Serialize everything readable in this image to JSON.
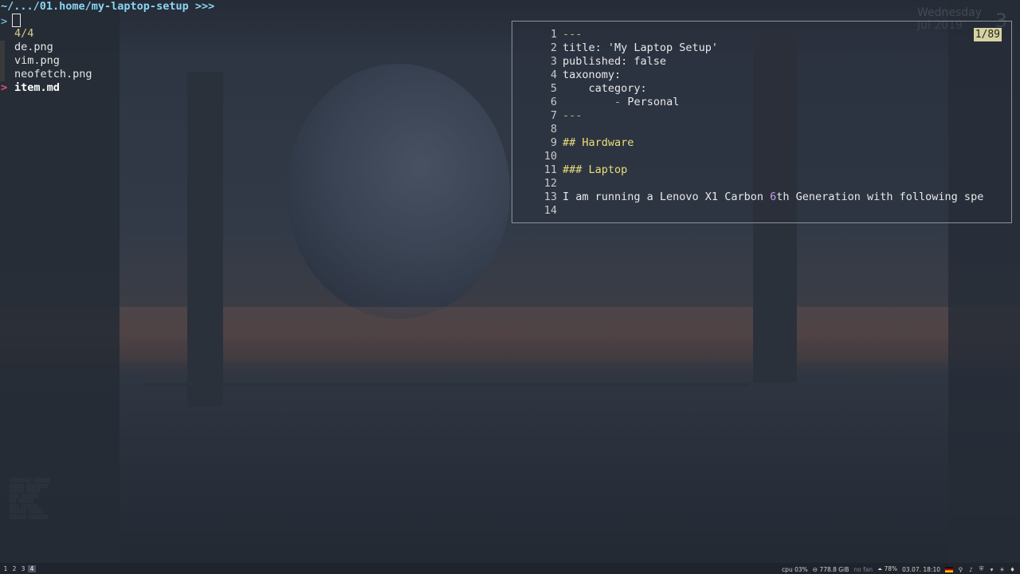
{
  "terminal": {
    "path": "~/.../01.home/my-laptop-setup",
    "prompt_suffix": ">>>",
    "input_prompt": ">",
    "count": "4/4",
    "selection_marker": ">",
    "files": [
      {
        "name": "de.png"
      },
      {
        "name": "vim.png"
      },
      {
        "name": "neofetch.png"
      },
      {
        "name": "item.md",
        "selected": true
      }
    ]
  },
  "preview": {
    "position": "1/89",
    "lines": [
      {
        "n": "1",
        "text": "---"
      },
      {
        "n": "2",
        "text": "title: 'My Laptop Setup'"
      },
      {
        "n": "3",
        "text": "published: false"
      },
      {
        "n": "4",
        "text": "taxonomy:"
      },
      {
        "n": "5",
        "text": "    category:"
      },
      {
        "n": "6",
        "bullet": "-",
        "text": "Personal"
      },
      {
        "n": "7",
        "text": "---"
      },
      {
        "n": "8",
        "text": ""
      },
      {
        "n": "9",
        "text": "## Hardware"
      },
      {
        "n": "10",
        "text": ""
      },
      {
        "n": "11",
        "text": "### Laptop"
      },
      {
        "n": "12",
        "text": ""
      },
      {
        "n": "13",
        "pre": "I am running a Lenovo X1 Carbon ",
        "num": "6",
        "post": "th Generation with following spe"
      },
      {
        "n": "14",
        "text": ""
      }
    ]
  },
  "conky": {
    "day": "Wednesday",
    "date": "Jul 2019",
    "day_num": "3"
  },
  "statusbar": {
    "workspaces": [
      "1",
      "2",
      "3",
      "4"
    ],
    "active_workspace": "4",
    "cpu_label": "cpu",
    "cpu_value": "03%",
    "disk": "778.8 GiB",
    "fan": "no fan",
    "battery": "78%",
    "datetime": "03.07. 18:10"
  },
  "colors": {
    "path": "#8ad4f2",
    "selection": "#e0507a",
    "yaml_dash": "#8fd16a",
    "heading": "#e9df7a",
    "number": "#c79be8"
  }
}
